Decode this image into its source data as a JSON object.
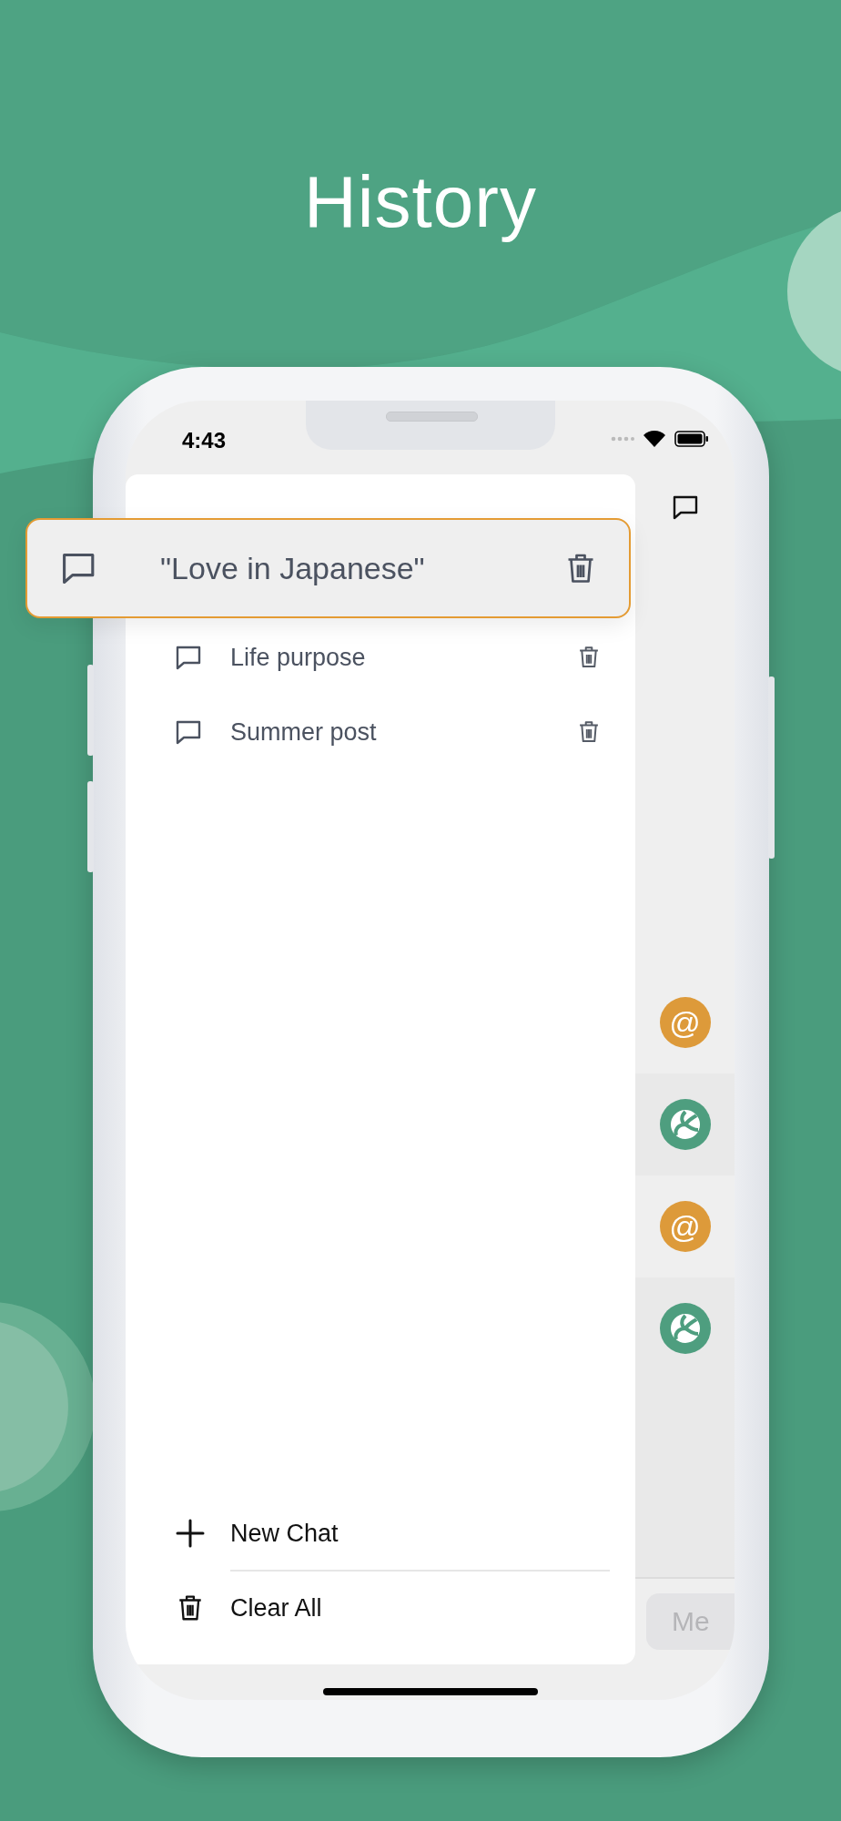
{
  "title": "History",
  "status_bar": {
    "time": "4:43"
  },
  "highlighted_chat": {
    "title": "\"Love in Japanese\""
  },
  "history": [
    {
      "title": "Life purpose"
    },
    {
      "title": "Summer post"
    }
  ],
  "drawer_actions": [
    {
      "kind": "new",
      "label": "New Chat"
    },
    {
      "kind": "clear",
      "label": "Clear All"
    }
  ],
  "chat": {
    "messages": [
      {
        "kind": "user",
        "avatar": "@"
      },
      {
        "kind": "assistant"
      },
      {
        "kind": "user",
        "avatar": "@"
      },
      {
        "kind": "assistant"
      }
    ],
    "input": {
      "placeholder": "Me"
    }
  }
}
